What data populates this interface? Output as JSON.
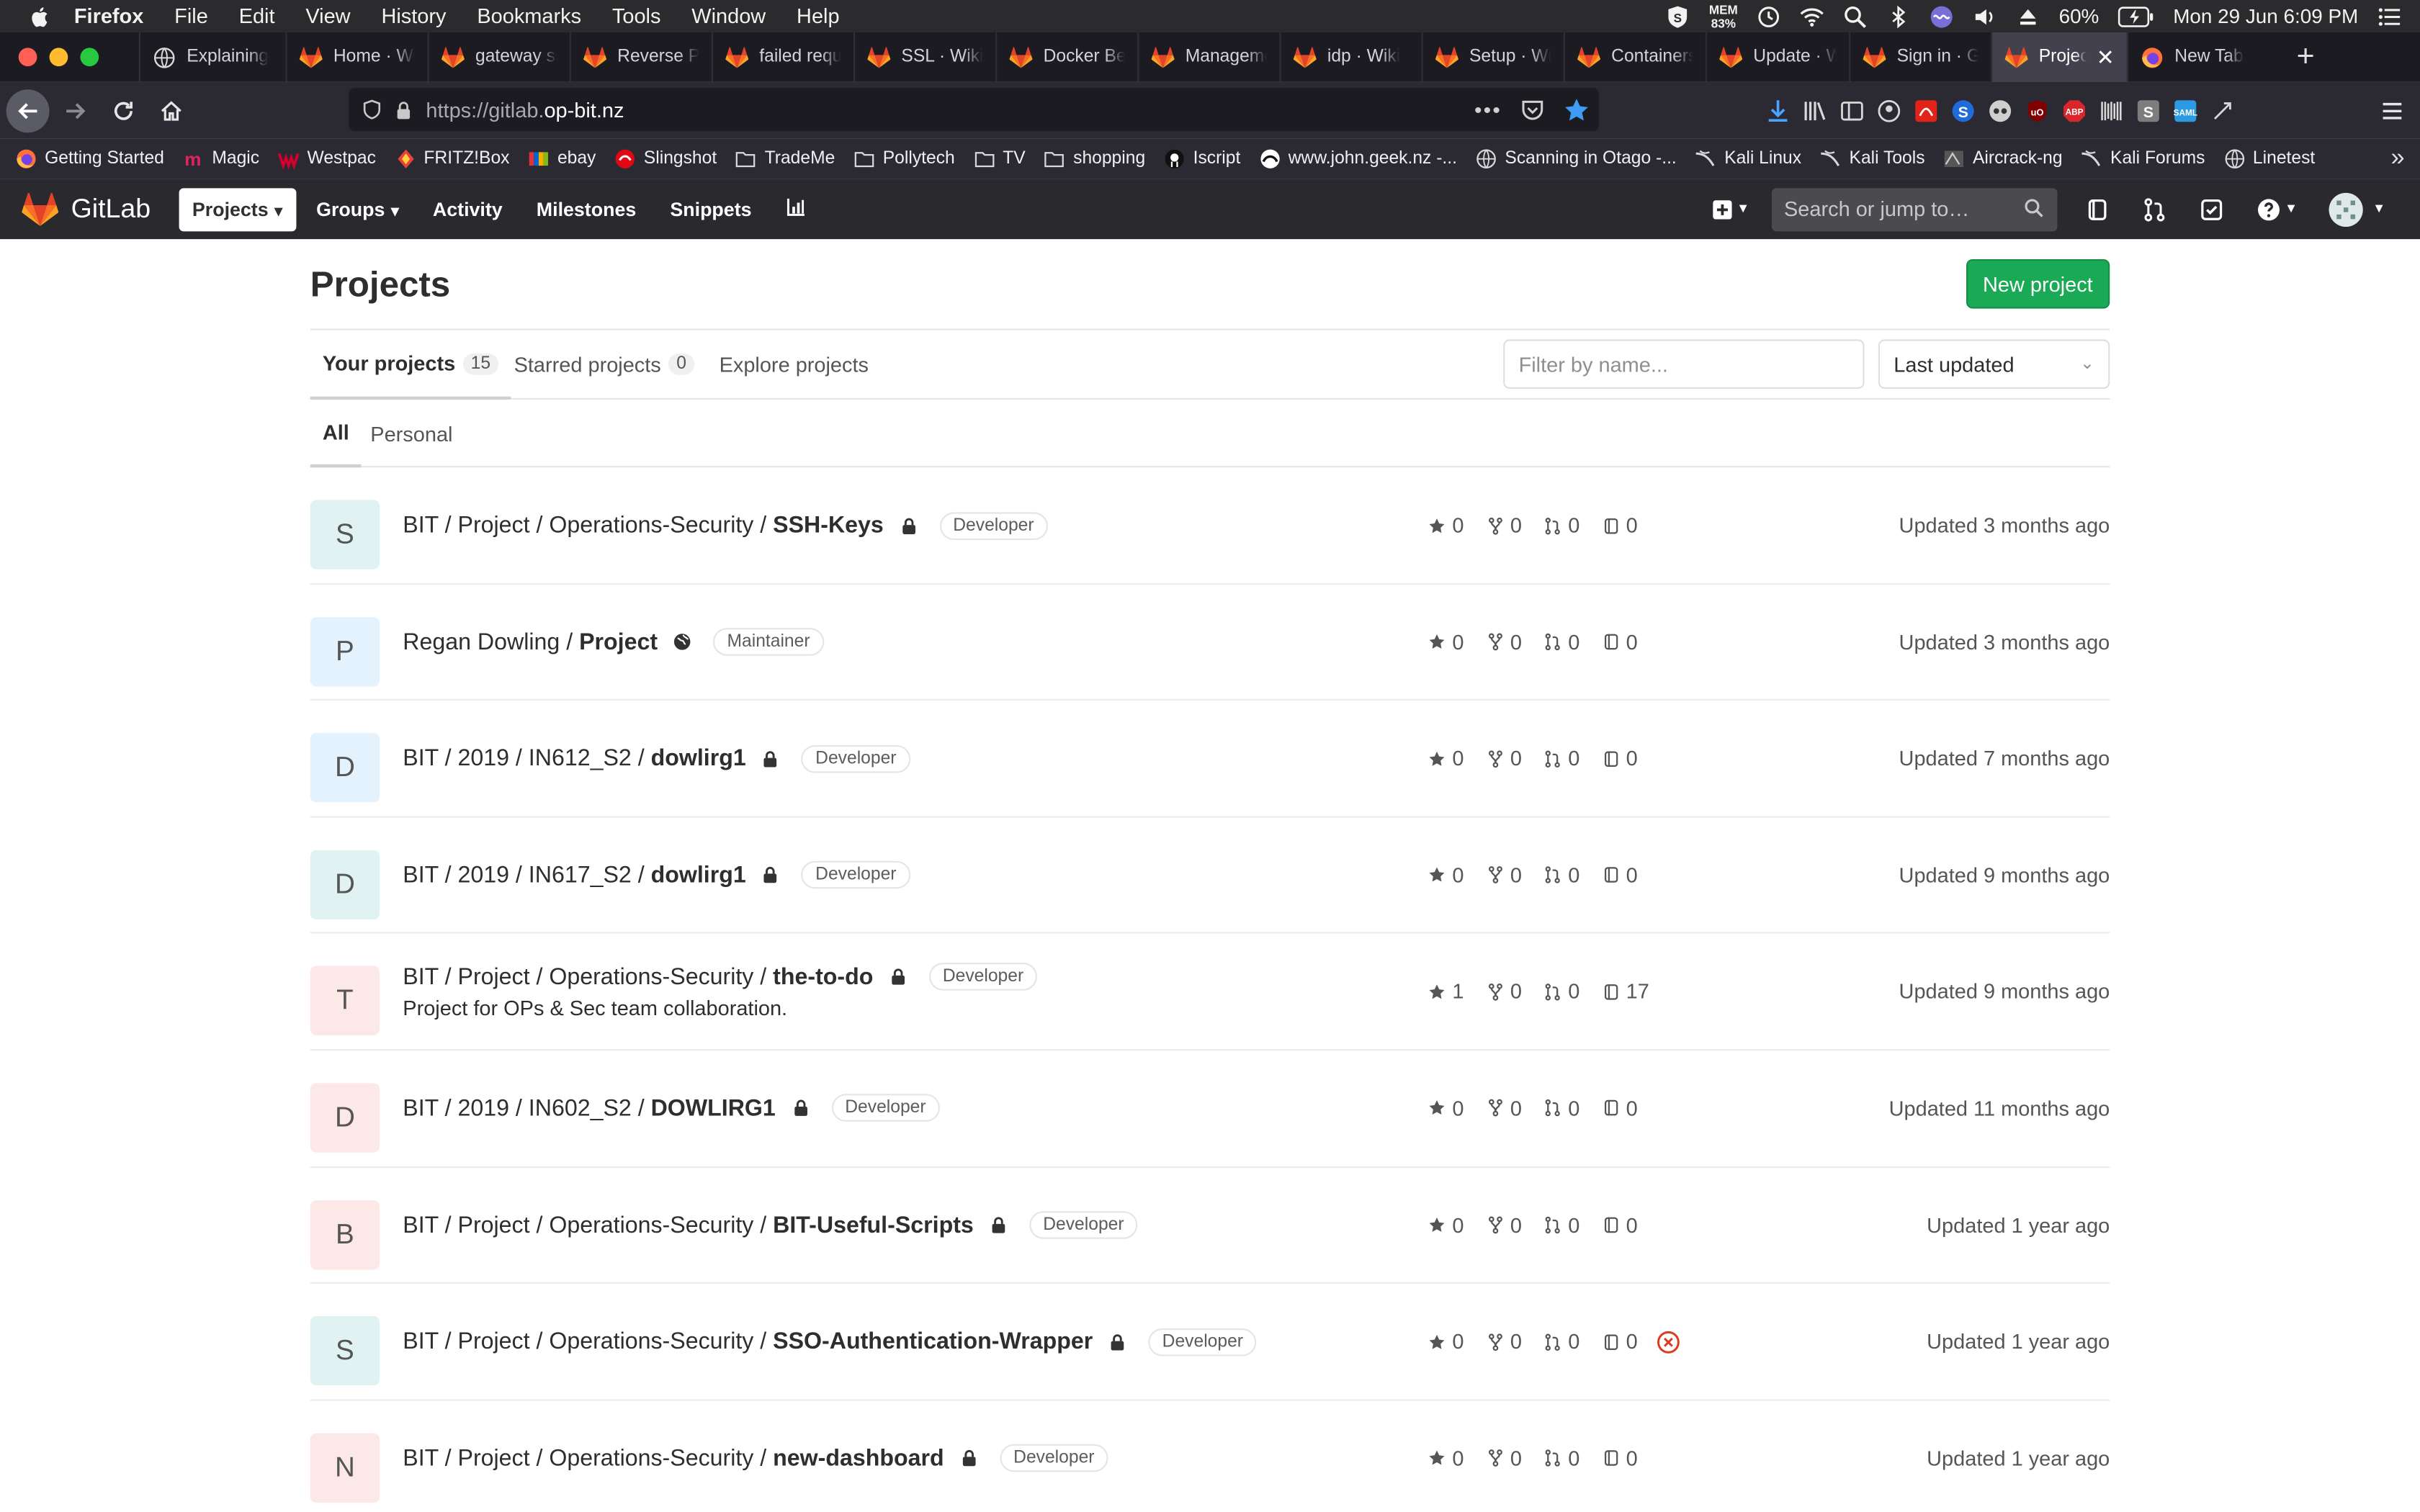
{
  "mac_menubar": {
    "app": "Firefox",
    "items": [
      "File",
      "Edit",
      "View",
      "History",
      "Bookmarks",
      "Tools",
      "Window",
      "Help"
    ],
    "mem_label": "MEM",
    "mem_value": "83%",
    "battery": "60%",
    "clock": "Mon 29 Jun  6:09 PM"
  },
  "browser_tabs": [
    {
      "label": "Explaining",
      "icon": "globe-icon"
    },
    {
      "label": "Home · Wiki",
      "icon": "gitlab-tab-icon"
    },
    {
      "label": "gateway ss",
      "icon": "gitlab-tab-icon"
    },
    {
      "label": "Reverse Pr",
      "icon": "gitlab-tab-icon"
    },
    {
      "label": "failed requ",
      "icon": "gitlab-tab-icon"
    },
    {
      "label": "SSL · Wiki",
      "icon": "gitlab-tab-icon"
    },
    {
      "label": "Docker Ber",
      "icon": "gitlab-tab-icon"
    },
    {
      "label": "Manageme",
      "icon": "gitlab-tab-icon"
    },
    {
      "label": "idp · Wiki",
      "icon": "gitlab-tab-icon"
    },
    {
      "label": "Setup · Wi",
      "icon": "gitlab-tab-icon"
    },
    {
      "label": "Containers",
      "icon": "gitlab-tab-icon"
    },
    {
      "label": "Update · W",
      "icon": "gitlab-tab-icon"
    },
    {
      "label": "Sign in · Gi",
      "icon": "gitlab-tab-icon"
    },
    {
      "label": "Projects",
      "icon": "gitlab-tab-icon",
      "active": true
    },
    {
      "label": "New Tab",
      "icon": "firefox-icon"
    }
  ],
  "url": {
    "prefix": "https://gitlab.",
    "domain": "op-bit.nz"
  },
  "bookmarks": [
    {
      "label": "Getting Started",
      "icon": "firefox-icon"
    },
    {
      "label": "Magic",
      "icon": "magic-icon"
    },
    {
      "label": "Westpac",
      "icon": "westpac-icon"
    },
    {
      "label": "FRITZ!Box",
      "icon": "fritzbox-icon"
    },
    {
      "label": "ebay",
      "icon": "ebay-icon"
    },
    {
      "label": "Slingshot",
      "icon": "slingshot-icon"
    },
    {
      "label": "TradeMe",
      "icon": "folder-icon"
    },
    {
      "label": "Pollytech",
      "icon": "folder-icon"
    },
    {
      "label": "TV",
      "icon": "folder-icon"
    },
    {
      "label": "shopping",
      "icon": "folder-icon"
    },
    {
      "label": "Iscript",
      "icon": "github-icon"
    },
    {
      "label": "www.john.geek.nz -...",
      "icon": "site-icon"
    },
    {
      "label": "Scanning in Otago -...",
      "icon": "globe-icon"
    },
    {
      "label": "Kali Linux",
      "icon": "kali-icon"
    },
    {
      "label": "Kali Tools",
      "icon": "kali-icon"
    },
    {
      "label": "Aircrack-ng",
      "icon": "aircrack-icon"
    },
    {
      "label": "Kali Forums",
      "icon": "kali-icon"
    },
    {
      "label": "Linetest",
      "icon": "globe-icon"
    }
  ],
  "gitlab_header": {
    "brand": "GitLab",
    "nav": [
      "Projects",
      "Groups",
      "Activity",
      "Milestones",
      "Snippets"
    ],
    "search_placeholder": "Search or jump to…"
  },
  "page": {
    "title": "Projects",
    "new_project": "New project",
    "tabs": [
      {
        "label": "Your projects",
        "count": "15"
      },
      {
        "label": "Starred projects",
        "count": "0"
      },
      {
        "label": "Explore projects"
      }
    ],
    "filter_placeholder": "Filter by name...",
    "sort": "Last updated",
    "subtabs": [
      "All",
      "Personal"
    ]
  },
  "projects": [
    {
      "letter": "S",
      "avatar_bg": "#e0f2f1",
      "path": "BIT / Project / Operations-Security / ",
      "name": "SSH-Keys",
      "visibility": "lock-icon",
      "role": "Developer",
      "stars": "0",
      "forks": "0",
      "mrs": "0",
      "issues": "0",
      "updated": "Updated 3 months ago"
    },
    {
      "letter": "P",
      "avatar_bg": "#e3f2fd",
      "path": "Regan Dowling / ",
      "name": "Project",
      "visibility": "globe-icon",
      "role": "Maintainer",
      "stars": "0",
      "forks": "0",
      "mrs": "0",
      "issues": "0",
      "updated": "Updated 3 months ago"
    },
    {
      "letter": "D",
      "avatar_bg": "#e3f2fd",
      "path": "BIT / 2019 / IN612_S2 / ",
      "name": "dowlirg1",
      "visibility": "lock-icon",
      "role": "Developer",
      "stars": "0",
      "forks": "0",
      "mrs": "0",
      "issues": "0",
      "updated": "Updated 7 months ago"
    },
    {
      "letter": "D",
      "avatar_bg": "#e0f2f1",
      "path": "BIT / 2019 / IN617_S2 / ",
      "name": "dowlirg1",
      "visibility": "lock-icon",
      "role": "Developer",
      "stars": "0",
      "forks": "0",
      "mrs": "0",
      "issues": "0",
      "updated": "Updated 9 months ago"
    },
    {
      "letter": "T",
      "avatar_bg": "#fde8e8",
      "path": "BIT / Project / Operations-Security / ",
      "name": "the-to-do",
      "visibility": "lock-icon",
      "role": "Developer",
      "description": "Project for OPs & Sec team collaboration.",
      "stars": "1",
      "forks": "0",
      "mrs": "0",
      "issues": "17",
      "updated": "Updated 9 months ago"
    },
    {
      "letter": "D",
      "avatar_bg": "#fde8e8",
      "path": "BIT / 2019 / IN602_S2 / ",
      "name": "DOWLIRG1",
      "visibility": "lock-icon",
      "role": "Developer",
      "stars": "0",
      "forks": "0",
      "mrs": "0",
      "issues": "0",
      "updated": "Updated 11 months ago"
    },
    {
      "letter": "B",
      "avatar_bg": "#fde8e8",
      "path": "BIT / Project / Operations-Security / ",
      "name": "BIT-Useful-Scripts",
      "visibility": "lock-icon",
      "role": "Developer",
      "stars": "0",
      "forks": "0",
      "mrs": "0",
      "issues": "0",
      "updated": "Updated 1 year ago"
    },
    {
      "letter": "S",
      "avatar_bg": "#e0f2f1",
      "path": "BIT / Project / Operations-Security / ",
      "name": "SSO-Authentication-Wrapper",
      "visibility": "lock-icon",
      "role": "Developer",
      "stars": "0",
      "forks": "0",
      "mrs": "0",
      "issues": "0",
      "pipeline": "failed",
      "updated": "Updated 1 year ago"
    },
    {
      "letter": "N",
      "avatar_bg": "#fde8e8",
      "path": "BIT / Project / Operations-Security / ",
      "name": "new-dashboard",
      "visibility": "lock-icon",
      "role": "Developer",
      "stars": "0",
      "forks": "0",
      "mrs": "0",
      "issues": "0",
      "updated": "Updated 1 year ago"
    }
  ],
  "colors": {
    "brand_green": "#1aaa55",
    "gitlab_orange": "#fc6d26",
    "header_bg": "#2a2a2e",
    "pipeline_failed": "#db3b21"
  }
}
